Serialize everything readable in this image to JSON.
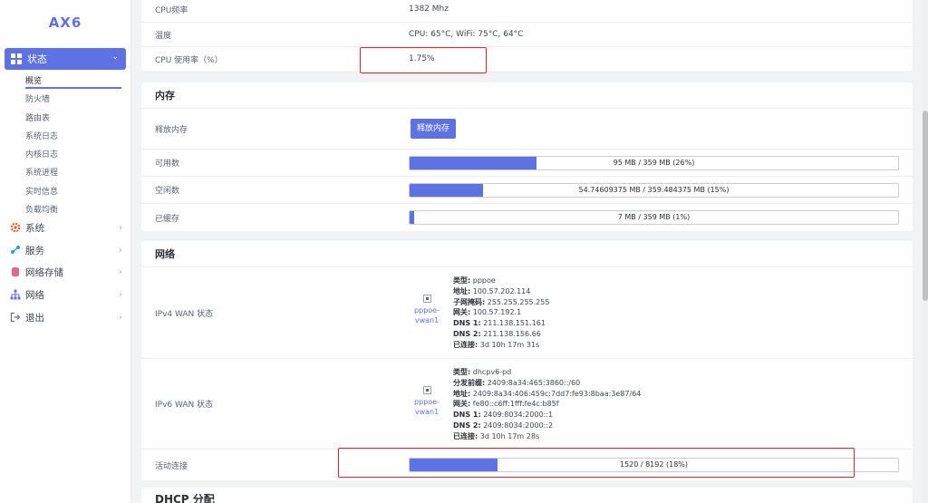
{
  "brand": "AX6",
  "sidebar": {
    "active": {
      "label": "状态"
    },
    "submenu": [
      "概览",
      "防火墙",
      "路由表",
      "系统日志",
      "内核日志",
      "系统进程",
      "实时信息",
      "负载均衡"
    ],
    "items": [
      {
        "label": "系统",
        "icon": "gear-icon"
      },
      {
        "label": "服务",
        "icon": "share-icon"
      },
      {
        "label": "网络存储",
        "icon": "database-icon"
      },
      {
        "label": "网络",
        "icon": "network-icon"
      },
      {
        "label": "退出",
        "icon": "logout-icon"
      }
    ]
  },
  "system_rows": [
    {
      "label": "CPU频率",
      "value": "1382 Mhz"
    },
    {
      "label": "温度",
      "value": "CPU: 65°C, WiFi: 75°C, 64°C"
    },
    {
      "label": "CPU 使用率（%）",
      "value": "1.75%"
    }
  ],
  "memory": {
    "title": "内存",
    "free_label": "释放内存",
    "free_button": "释放内存",
    "bars": [
      {
        "label": "可用数",
        "text": "95 MB / 359 MB (26%)",
        "percent": 26
      },
      {
        "label": "空闲数",
        "text": "54.74609375 MB / 359.484375 MB (15%)",
        "percent": 15
      },
      {
        "label": "已缓存",
        "text": "7 MB / 359 MB (1%)",
        "percent": 1
      }
    ]
  },
  "network": {
    "title": "网络",
    "ipv4": {
      "label": "IPv4 WAN 状态",
      "device": [
        "pppoe-",
        "vwan1"
      ],
      "info": [
        {
          "k": "类型:",
          "v": " pppoe"
        },
        {
          "k": "地址:",
          "v": " 100.57.202.114"
        },
        {
          "k": "子网掩码:",
          "v": " 255.255.255.255"
        },
        {
          "k": "网关:",
          "v": " 100.57.192.1"
        },
        {
          "k": "DNS 1:",
          "v": " 211.138.151.161"
        },
        {
          "k": "DNS 2:",
          "v": " 211.138.156.66"
        },
        {
          "k": "已连接:",
          "v": " 3d 10h 17m 31s"
        }
      ]
    },
    "ipv6": {
      "label": "IPv6 WAN 状态",
      "device": [
        "pppoe-",
        "vwan1"
      ],
      "info": [
        {
          "k": "类型:",
          "v": " dhcpv6-pd"
        },
        {
          "k": "分发前缀:",
          "v": " 2409:8a34:465:3860::/60"
        },
        {
          "k": "地址:",
          "v": " 2409:8a34:406:459c:7dd7:fe93:8baa:3e87/64"
        },
        {
          "k": "网关:",
          "v": " fe80::c6ff:1fff:fe4c:b85f"
        },
        {
          "k": "DNS 1:",
          "v": " 2409:8034:2000::1"
        },
        {
          "k": "DNS 2:",
          "v": " 2409:8034:2000::2"
        },
        {
          "k": "已连接:",
          "v": " 3d 10h 17m 28s"
        }
      ]
    },
    "connections": {
      "label": "活动连接",
      "text": "1520 / 8192 (18%)",
      "percent": 18
    }
  },
  "dhcp": {
    "title": "DHCP 分配"
  },
  "colors": {
    "accent": "#5e72e4",
    "highlight": "#e3262c"
  }
}
